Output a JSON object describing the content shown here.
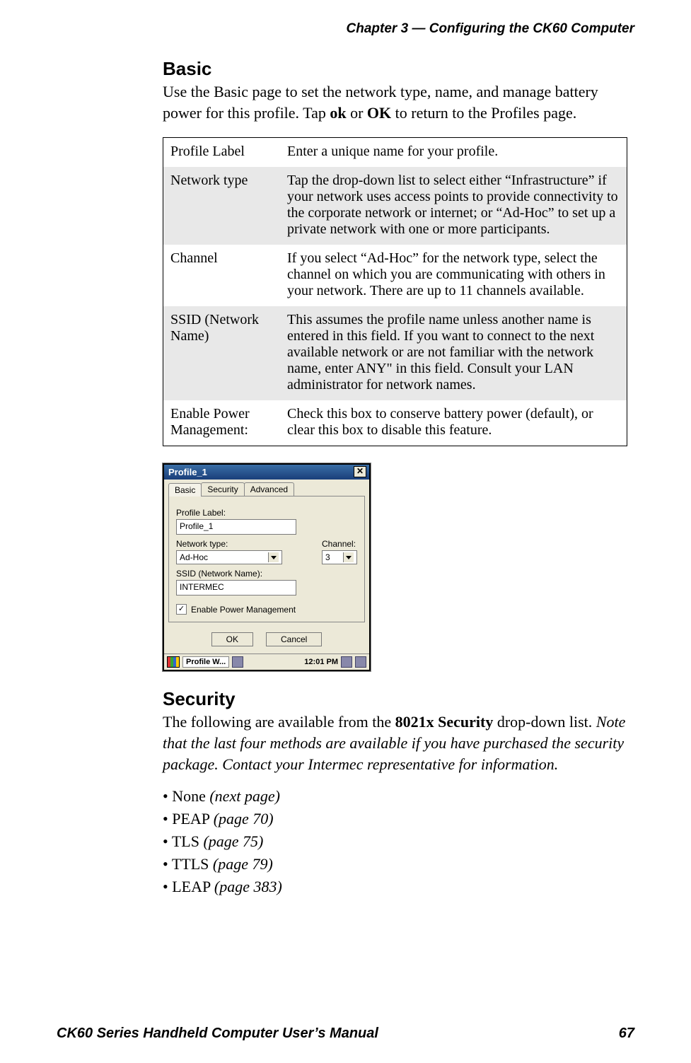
{
  "running_head": "Chapter 3 —  Configuring the CK60 Computer",
  "sections": {
    "basic": {
      "heading": "Basic",
      "intro_parts": {
        "p1": "Use the Basic page to set the network type, name, and manage battery power for this profile. Tap ",
        "b1": "ok",
        "p2": " or ",
        "b2": "OK",
        "p3": " to return to the Profiles page."
      }
    },
    "security": {
      "heading": "Security",
      "intro_parts": {
        "p1": "The following are available from the ",
        "b1": "8021x Security",
        "p2": " drop-down list. ",
        "i1": "Note that the last four methods are available if you have purchased the security package. Contact your Intermec representative for information."
      }
    }
  },
  "table": {
    "rows": [
      {
        "key": "Profile Label",
        "val": "Enter a unique name for your profile."
      },
      {
        "key": "Network type",
        "val": "Tap the drop-down list to select either “Infrastructure” if your network uses access points to provide connectivity to the corporate network or internet; or “Ad-Hoc” to set up a private network with one or more participants."
      },
      {
        "key": "Channel",
        "val": "If you select “Ad-Hoc” for the network type, select the channel on which you are communicating with others in your network. There are up to 11 channels available."
      },
      {
        "key": "SSID (Network Name)",
        "val": "This assumes the profile name unless another name is entered in this field. If you want to connect to the next available network or are not familiar with the network name, enter ANY\" in this field. Consult your LAN administrator for network names."
      },
      {
        "key": "Enable Power Management:",
        "val": "Check this box to conserve battery power (default), or clear this box to disable this feature."
      }
    ]
  },
  "dialog": {
    "title": "Profile_1",
    "close_glyph": "✕",
    "tabs": {
      "basic": "Basic",
      "security": "Security",
      "advanced": "Advanced"
    },
    "labels": {
      "profile_label": "Profile Label:",
      "network_type": "Network type:",
      "channel": "Channel:",
      "ssid": "SSID (Network Name):",
      "enable_pm": "Enable Power Management"
    },
    "values": {
      "profile_label": "Profile_1",
      "network_type": "Ad-Hoc",
      "channel": "3",
      "ssid": "INTERMEC",
      "enable_pm_checked": "✓"
    },
    "buttons": {
      "ok": "OK",
      "cancel": "Cancel"
    },
    "taskbar": {
      "app": "Profile W...",
      "clock": "12:01 PM"
    }
  },
  "bullets": [
    {
      "name": "None",
      "ref": "(next page)"
    },
    {
      "name": "PEAP",
      "ref": "(page 70)"
    },
    {
      "name": "TLS",
      "ref": "(page 75)"
    },
    {
      "name": "TTLS",
      "ref": "(page 79)"
    },
    {
      "name": "LEAP",
      "ref": "(page 383)"
    }
  ],
  "footer": {
    "left": "CK60 Series Handheld Computer User’s Manual",
    "right": "67"
  }
}
